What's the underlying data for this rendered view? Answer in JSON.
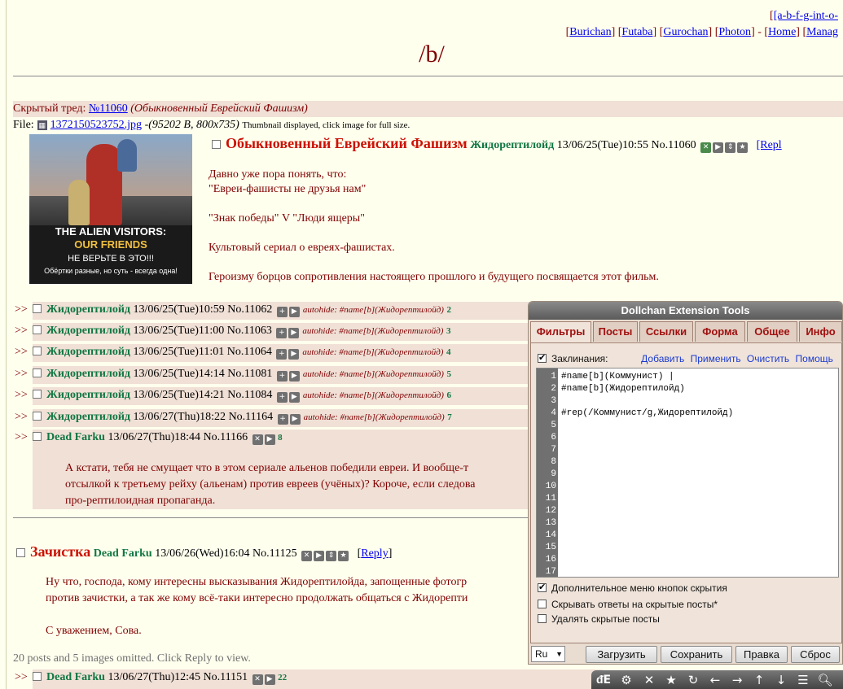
{
  "nav": {
    "boards": "[a-b-f-g-int-o-",
    "links": [
      "Burichan",
      "Futaba",
      "Gurochan",
      "Photon"
    ],
    "home": "Home",
    "manage": "Manag"
  },
  "board_title": "/b/",
  "hidden_thread": {
    "prefix": "Скрытый тред: ",
    "number": "№11060",
    "subject": "(Обыкновенный Еврейский Фашизм)"
  },
  "file": {
    "label": "File:",
    "name": "1372150523752.jpg",
    "meta": "-(95202 B, 800x735)",
    "note": "Thumbnail displayed, click image for full size."
  },
  "thumb_text": {
    "line1": "THE ALIEN VISITORS:",
    "line2": "OUR FRIENDS",
    "line3": "НЕ ВЕРЬТЕ В ЭТО!!!",
    "line4": "Обёртки разные, но суть - всегда одна!"
  },
  "op": {
    "subject": "Обыкновенный Еврейский Фашизм",
    "name": "Жидорептилойд",
    "date": "13/06/25(Tue)10:55",
    "no": "No.11060",
    "reply": "[Repl",
    "body": [
      "Давно уже пора понять, что:",
      "\"Евреи-фашисты не друзья нам\"",
      "\"Знак победы\" V \"Люди ящеры\"",
      "Культовый сериал о евреях-фашистах.",
      "Героизму борцов сопротивления настоящего прошлого и будущего посвящается этот фильм."
    ]
  },
  "replies": [
    {
      "arrows": ">>",
      "name": "Жидорептилойд",
      "date": "13/06/25(Tue)10:59",
      "no": "No.11062",
      "autohide": "autohide: #name[b](Жидорептилойд)",
      "n": "2"
    },
    {
      "arrows": ">>",
      "name": "Жидорептилойд",
      "date": "13/06/25(Tue)11:00",
      "no": "No.11063",
      "autohide": "autohide: #name[b](Жидорептилойд)",
      "n": "3"
    },
    {
      "arrows": ">>",
      "name": "Жидорептилойд",
      "date": "13/06/25(Tue)11:01",
      "no": "No.11064",
      "autohide": "autohide: #name[b](Жидорептилойд)",
      "n": "4"
    },
    {
      "arrows": ">>",
      "name": "Жидорептилойд",
      "date": "13/06/25(Tue)14:14",
      "no": "No.11081",
      "autohide": "autohide: #name[b](Жидорептилойд)",
      "n": "5"
    },
    {
      "arrows": ">>",
      "name": "Жидорептилойд",
      "date": "13/06/25(Tue)14:21",
      "no": "No.11084",
      "autohide": "autohide: #name[b](Жидорептилойд)",
      "n": "6"
    },
    {
      "arrows": ">>",
      "name": "Жидорептилойд",
      "date": "13/06/27(Thu)18:22",
      "no": "No.11164",
      "autohide": "autohide: #name[b](Жидорептилойд)",
      "n": "7"
    }
  ],
  "reply8": {
    "arrows": ">>",
    "name": "Dead Farku",
    "date": "13/06/27(Thu)18:44",
    "no": "No.11166",
    "n": "8",
    "body": [
      "А кстати, тебя не смущает что в этом сериале альенов победили евреи. И вообще-т",
      "отсылкой к третьему рейху (альенам) против евреев (учёных)? Короче, если следова",
      "про-рептилоидная пропаганда."
    ]
  },
  "thread2": {
    "subject": "Зачистка",
    "name": "Dead Farku",
    "date": "13/06/26(Wed)16:04",
    "no": "No.11125",
    "reply": "Reply",
    "body": [
      "Ну что, господа, кому интересны высказывания Жидорептилойда, запощенные фотогр",
      "против зачистки, а так же кому всё-таки интересно продолжать общаться с Жидорепти",
      "С уважением, Сова."
    ]
  },
  "omitted": "20 posts and 5 images omitted. Click Reply to view.",
  "last_reply": {
    "arrows": ">>",
    "name": "Dead Farku",
    "date": "13/06/27(Thu)12:45",
    "no": "No.11151",
    "n": "22"
  },
  "panel": {
    "title": "Dollchan Extension Tools",
    "tabs": [
      "Фильтры",
      "Посты",
      "Ссылки",
      "Форма",
      "Общее",
      "Инфо"
    ],
    "spells_label": "Заклинания:",
    "spell_links": [
      "Добавить",
      "Применить",
      "Очистить",
      "Помощь"
    ],
    "code": [
      "#name[b](Коммунист) |",
      "#name[b](Жидорептилойд)",
      "",
      "#rep(/Коммунист/g,Жидорептилойд)",
      "",
      "",
      "",
      "",
      "",
      "",
      "",
      "",
      "",
      "",
      "",
      "",
      ""
    ],
    "options": [
      {
        "label": "Дополнительное меню кнопок скрытия",
        "checked": true
      },
      {
        "label": "Скрывать ответы на скрытые посты*",
        "checked": false
      },
      {
        "label": "Удалять скрытые посты",
        "checked": false
      }
    ],
    "lang": "Ru",
    "buttons": [
      "Загрузить",
      "Сохранить",
      "Правка",
      "Сброс"
    ]
  }
}
